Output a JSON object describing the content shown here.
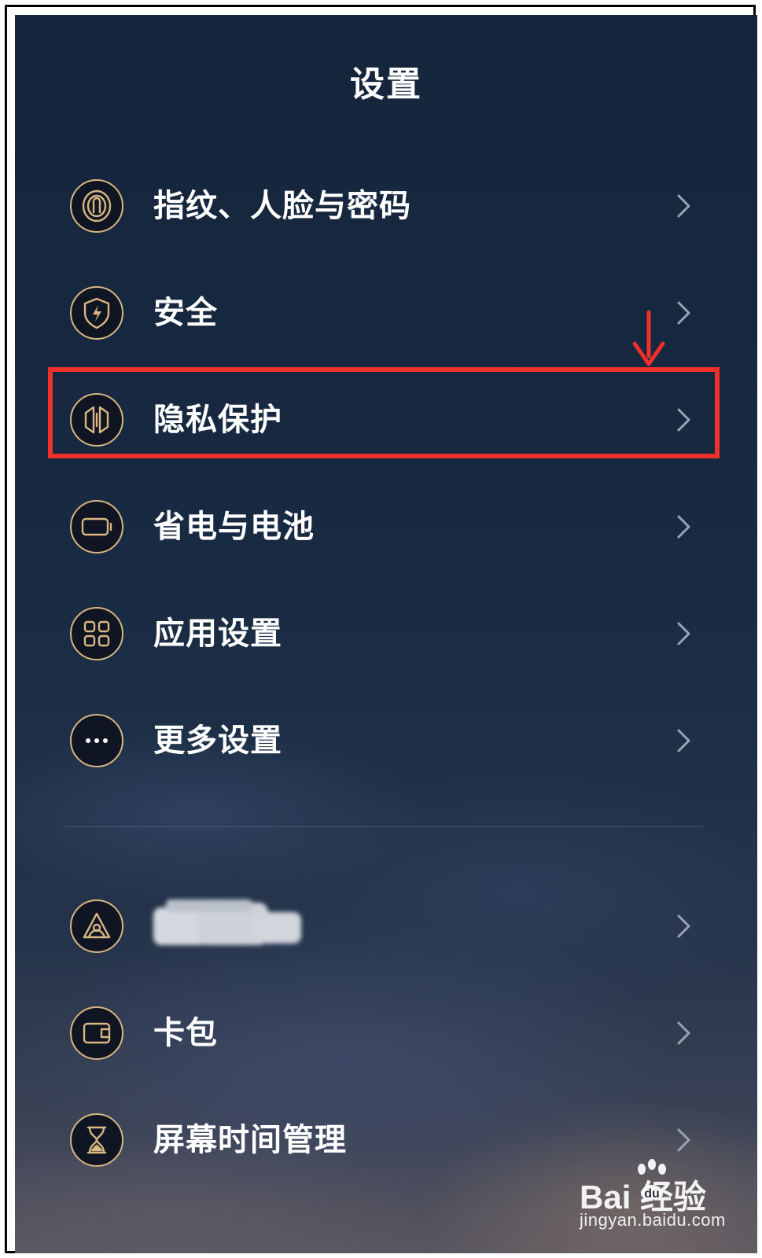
{
  "header": {
    "title": "设置"
  },
  "settings": {
    "items": [
      {
        "label": "指纹、人脸与密码",
        "icon": "fingerprint-icon"
      },
      {
        "label": "安全",
        "icon": "shield-icon"
      },
      {
        "label": "隐私保护",
        "icon": "privacy-icon"
      },
      {
        "label": "省电与电池",
        "icon": "battery-icon"
      },
      {
        "label": "应用设置",
        "icon": "app-grid-icon"
      },
      {
        "label": "更多设置",
        "icon": "more-icon"
      },
      {
        "label": "",
        "icon": "account-icon",
        "label_obscured": true
      },
      {
        "label": "卡包",
        "icon": "wallet-icon"
      },
      {
        "label": "屏幕时间管理",
        "icon": "hourglass-icon"
      }
    ],
    "highlighted_item": "隐私保护"
  },
  "annotation": {
    "highlight_color": "#f0302a"
  },
  "theme": {
    "icon_ring_color": "#d8b682",
    "text_color": "#ffffff"
  },
  "watermark": {
    "brand": "Bai  经验",
    "url": "jingyan.baidu.com"
  }
}
